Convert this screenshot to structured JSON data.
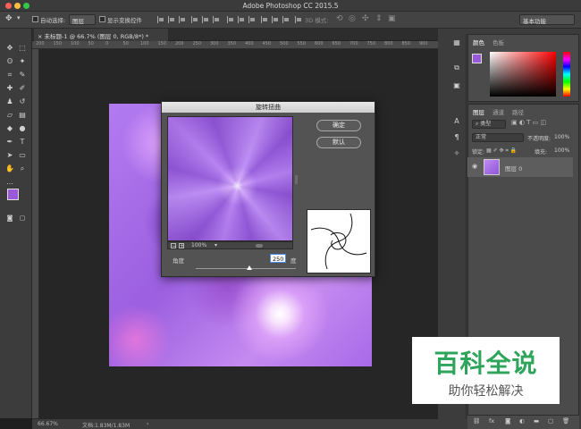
{
  "app": {
    "title": "Adobe Photoshop CC 2015.5"
  },
  "options_bar": {
    "auto_select_label": "自动选择:",
    "auto_select_value": "图层",
    "show_transform_label": "显示变换控件",
    "mode_3d_label": "3D 模式:",
    "workspace_value": "基本功能"
  },
  "document": {
    "tab_title": "未标题-1 @ 66.7% (图层 0, RGB/8*) *"
  },
  "ruler": {
    "ticks": [
      "200",
      "150",
      "100",
      "50",
      "0",
      "50",
      "100",
      "150",
      "200",
      "250",
      "300",
      "350",
      "400",
      "450",
      "500",
      "550",
      "600",
      "650",
      "700",
      "750",
      "800",
      "850",
      "900"
    ]
  },
  "status": {
    "zoom": "66.67%",
    "doc_info": "文档:1.83M/1.83M"
  },
  "panels": {
    "color_tab": "颜色",
    "swatches_tab": "色板",
    "layers_tab": "图层",
    "channels_tab": "通道",
    "paths_tab": "路径",
    "kind_filter": "类型",
    "blend_mode": "正常",
    "opacity_label": "不透明度:",
    "opacity_value": "100%",
    "lock_label": "锁定:",
    "fill_label": "填充:",
    "fill_value": "100%",
    "layer_name": "图层 0",
    "footer_fx": "fx"
  },
  "dialog": {
    "title": "旋转扭曲",
    "ok_label": "确定",
    "reset_label": "默认",
    "zoom_value": "100%",
    "angle_label": "角度",
    "angle_value": "250",
    "angle_unit": "度"
  },
  "watermark": {
    "line1": "百科全说",
    "line2": "助你轻松解决"
  },
  "colors": {
    "foreground": "#9a5ad8",
    "accent_green": "#2ea55a"
  }
}
